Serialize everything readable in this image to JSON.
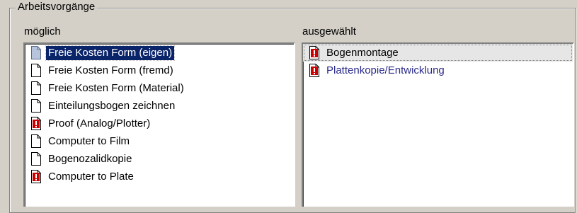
{
  "group": {
    "title": "Arbeitsvorgänge"
  },
  "available": {
    "label": "möglich",
    "items": [
      {
        "label": "Freie Kosten Form (eigen)",
        "icon": "document-icon",
        "selected": true
      },
      {
        "label": "Freie Kosten Form (fremd)",
        "icon": "document-icon"
      },
      {
        "label": "Freie Kosten Form (Material)",
        "icon": "document-icon"
      },
      {
        "label": "Einteilungsbogen zeichnen",
        "icon": "document-icon"
      },
      {
        "label": "Proof (Analog/Plotter)",
        "icon": "warning-document-icon"
      },
      {
        "label": "Computer to Film",
        "icon": "document-icon"
      },
      {
        "label": "Bogenozalidkopie",
        "icon": "document-icon"
      },
      {
        "label": "Computer to Plate",
        "icon": "warning-document-icon"
      }
    ]
  },
  "selected": {
    "label": "ausgewählt",
    "items": [
      {
        "label": "Bogenmontage",
        "icon": "warning-document-icon"
      },
      {
        "label": "Plattenkopie/Entwicklung",
        "icon": "warning-document-icon"
      }
    ]
  },
  "colors": {
    "selection": "#0a246a",
    "warning": "#cc0000",
    "window": "#d4d0c8"
  }
}
